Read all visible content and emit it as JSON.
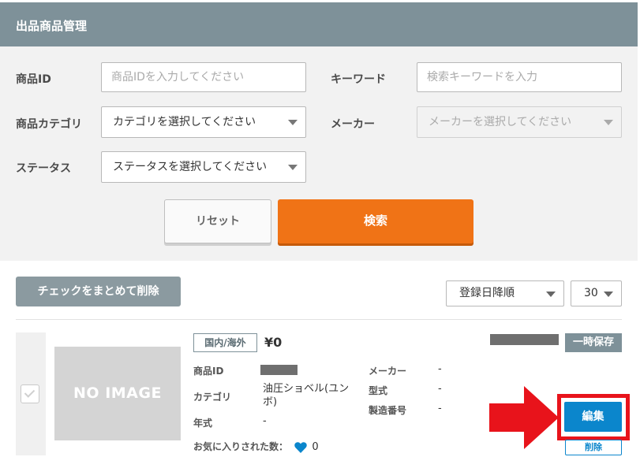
{
  "header": {
    "title": "出品商品管理"
  },
  "search": {
    "product_id": {
      "label": "商品ID",
      "placeholder": "商品IDを入力してください"
    },
    "keyword": {
      "label": "キーワード",
      "placeholder": "検索キーワードを入力"
    },
    "category": {
      "label": "商品カテゴリ",
      "selected": "カテゴリを選択してください"
    },
    "maker": {
      "label": "メーカー",
      "selected": "メーカーを選択してください"
    },
    "status": {
      "label": "ステータス",
      "selected": "ステータスを選択してください"
    },
    "reset_label": "リセット",
    "search_label": "検索"
  },
  "list_controls": {
    "bulk_delete_label": "チェックをまとめて削除",
    "sort_selected": "登録日降順",
    "per_page_selected": "30"
  },
  "listing": {
    "image_placeholder": "NO IMAGE",
    "region_badge": "国内/海外",
    "price": "¥0",
    "status_badge": "一時保存",
    "labels": {
      "product_id": "商品ID",
      "category": "カテゴリ",
      "year": "年式",
      "maker": "メーカー",
      "model": "型式",
      "serial": "製造番号"
    },
    "values": {
      "category": "油圧ショベル(ユンボ)",
      "year": "-",
      "maker": "-",
      "model": "-",
      "serial": "-"
    },
    "favorites_label": "お気に入りされた数：",
    "favorites_count": "0",
    "edit_label": "編集",
    "delete_label": "削除"
  },
  "colors": {
    "header": "#7e9199",
    "search_button": "#f07316",
    "edit_button": "#0b86cc",
    "highlight": "#e8131b",
    "heart": "#0b86cc"
  }
}
